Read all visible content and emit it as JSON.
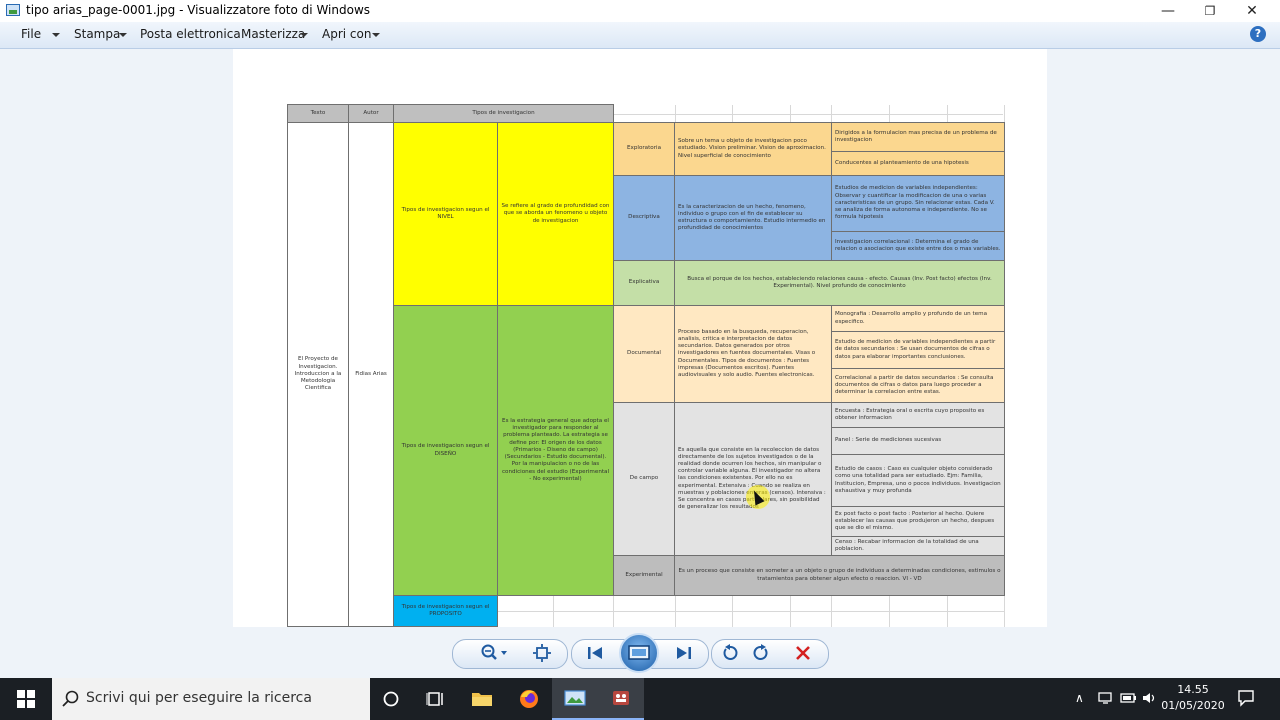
{
  "window": {
    "title": "tipo arias_page-0001.jpg - Visualizzatore foto di Windows",
    "minimize": "—",
    "maximize": "❐",
    "close": "✕"
  },
  "menu": {
    "file": "File",
    "print": "Stampa",
    "email": "Posta elettronica",
    "burn": "Masterizza",
    "open_with": "Apri con",
    "help": "?"
  },
  "doc": {
    "headers": {
      "texto": "Texto",
      "autor": "Autor",
      "tipos": "Tipos de investigacion"
    },
    "texto_value": "El Proyecto de Investigacion. Introduccion a la Metodologia Cientifica",
    "autor_value": "Fidias Arias",
    "nivel": {
      "label": "Tipos de investigacion segun el NIVEL",
      "desc": "Se refiere al grado de profundidad con que se aborda un fenomeno u objeto de investigacion",
      "exploratoria": {
        "name": "Exploratoria",
        "desc": "Sobre un tema u objeto de investigacion poco estudiado. Vision preliminar. Vision de aproximacion. Nivel superficial de conocimiento",
        "sub1": "Dirigidos a la formulacion mas precisa de un problema de investigacion",
        "sub2": "Conducentes al planteamiento de una hipotesis"
      },
      "descriptiva": {
        "name": "Descriptiva",
        "desc": "Es la caracterizacion de un hecho, fenomeno, individuo o grupo con el fin de establecer su estructura o comportamiento. Estudio intermedio en profundidad de conocimientos",
        "sub1": "Estudios de medicion de variables independientes: Observar y cuantificar la modificacion de una o varias caracteristicas de un grupo. Sin relacionar estas. Cada V. se analiza de forma autonoma e independiente. No se formula hipotesis",
        "sub2": "Investigacion correlacional : Determina el grado de relacion o asociacion que existe entre dos o mas variables."
      },
      "explicativa": {
        "name": "Explicativa",
        "desc": "Busca el porque de los hechos, estableciendo relaciones causa - efecto. Causas (Inv. Post facto) efectos (Inv. Experimental). Nivel profundo de conocimiento"
      }
    },
    "diseno": {
      "label": "Tipos de investigacion segun el DISEÑO",
      "desc": "Es la estrategia general que adopta el investigador para responder al problema planteado. La estrategia se define por: El origen de los datos (Primarios - Diseno de campo) (Secundarios - Estudio documental). Por la manipulacion o no de las condiciones del estudio (Experimental - No experimental)",
      "documental": {
        "name": "Documental",
        "desc": "Proceso basado en la busqueda, recuperacion, analisis, critica e interpretacion de datos secundarios. Datos generados por otros investigadores en fuentes documentales. Visas o Documentales. Tipos de documentos : Fuentes impresas (Documentos escritos). Fuentes audiovisuales y solo audio. Fuentes electronicas.",
        "sub1": "Monografia : Desarrollo amplio y profundo de un tema especifico.",
        "sub2": "Estudio de medicion de variables independientes a partir de datos secundarios : Se usan documentos de cifras o datos para elaborar importantes conclusiones.",
        "sub3": "Correlacional a partir de datos secundarios : Se consulta documentos de cifras o datos para luego proceder a determinar la correlacion entre estas."
      },
      "campo": {
        "name": "De campo",
        "desc": "Es aquella que consiste en la recoleccion de datos directamente de los sujetos investigados o de la realidad donde ocurren los hechos, sin manipular o controlar variable alguna. El investigador no altera las condiciones existentes. Por ello no es experimental. Extensiva : Cuando se realiza en muestras y poblaciones enteras (censos). Intensiva : Se concentra en casos particulares, sin posibilidad de generalizar los resultados",
        "sub1": "Encuesta : Estrategia oral o escrita cuyo proposito es obtener informacion",
        "sub2": "Panel : Serie de mediciones sucesivas",
        "sub3": "Estudio de casos : Caso es cualquier objeto considerado como una totalidad para ser estudiado. Ejm: Familia, Institucion, Empresa, uno o pocos individuos. Investigacion exhaustiva y muy profunda",
        "sub4": "Ex post facto o post facto : Posterior al hecho. Quiere establecer las causas que produjeron un hecho, despues que se dio el mismo.",
        "sub5": "Censo : Recabar informacion de la totalidad de una poblacion."
      },
      "experimental": {
        "name": "Experimental",
        "desc": "Es un proceso que consiste en someter a un objeto o grupo de individuos a determinadas condiciones, estimulos o tratamientos para obtener algun efecto o reaccion. VI - VD"
      }
    },
    "proposito": {
      "label": "Tipos de investigacion segun el PROPOSITO"
    }
  },
  "taskbar": {
    "search_placeholder": "Scrivi qui per eseguire la ricerca",
    "time": "14.55",
    "date": "01/05/2020"
  }
}
